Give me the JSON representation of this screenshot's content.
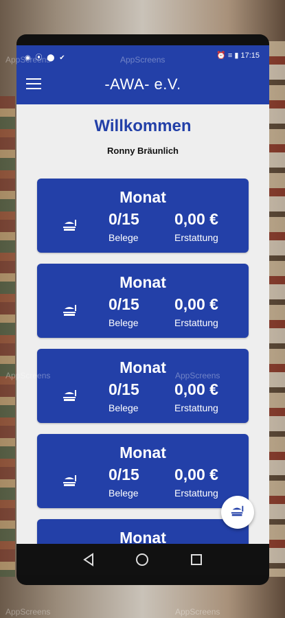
{
  "status_bar": {
    "left_icons": "◉ ⦿ ⬤ ✔",
    "right_icons": "⏰ ≡ ▮",
    "time": "17:15"
  },
  "app_bar": {
    "title": "-AWA- e.V.",
    "menu_icon": "hamburger-menu-icon"
  },
  "main": {
    "welcome": "Willkommen",
    "user_name": "Ronny Bräunlich",
    "cards": [
      {
        "title": "Monat",
        "receipts_value": "0/15",
        "receipts_label": "Belege",
        "refund_value": "0,00 €",
        "refund_label": "Erstattung"
      },
      {
        "title": "Monat",
        "receipts_value": "0/15",
        "receipts_label": "Belege",
        "refund_value": "0,00 €",
        "refund_label": "Erstattung"
      },
      {
        "title": "Monat",
        "receipts_value": "0/15",
        "receipts_label": "Belege",
        "refund_value": "0,00 €",
        "refund_label": "Erstattung"
      },
      {
        "title": "Monat",
        "receipts_value": "0/15",
        "receipts_label": "Belege",
        "refund_value": "0,00 €",
        "refund_label": "Erstattung"
      },
      {
        "title": "Monat"
      }
    ]
  },
  "fab": {
    "icon": "food-receipt-icon"
  },
  "nav": {
    "back_icon": "back-triangle-icon",
    "home_icon": "home-circle-icon",
    "recent_icon": "recent-square-icon"
  },
  "watermark": "AppScreens",
  "colors": {
    "primary": "#2340a8",
    "background": "#eeeeee"
  }
}
